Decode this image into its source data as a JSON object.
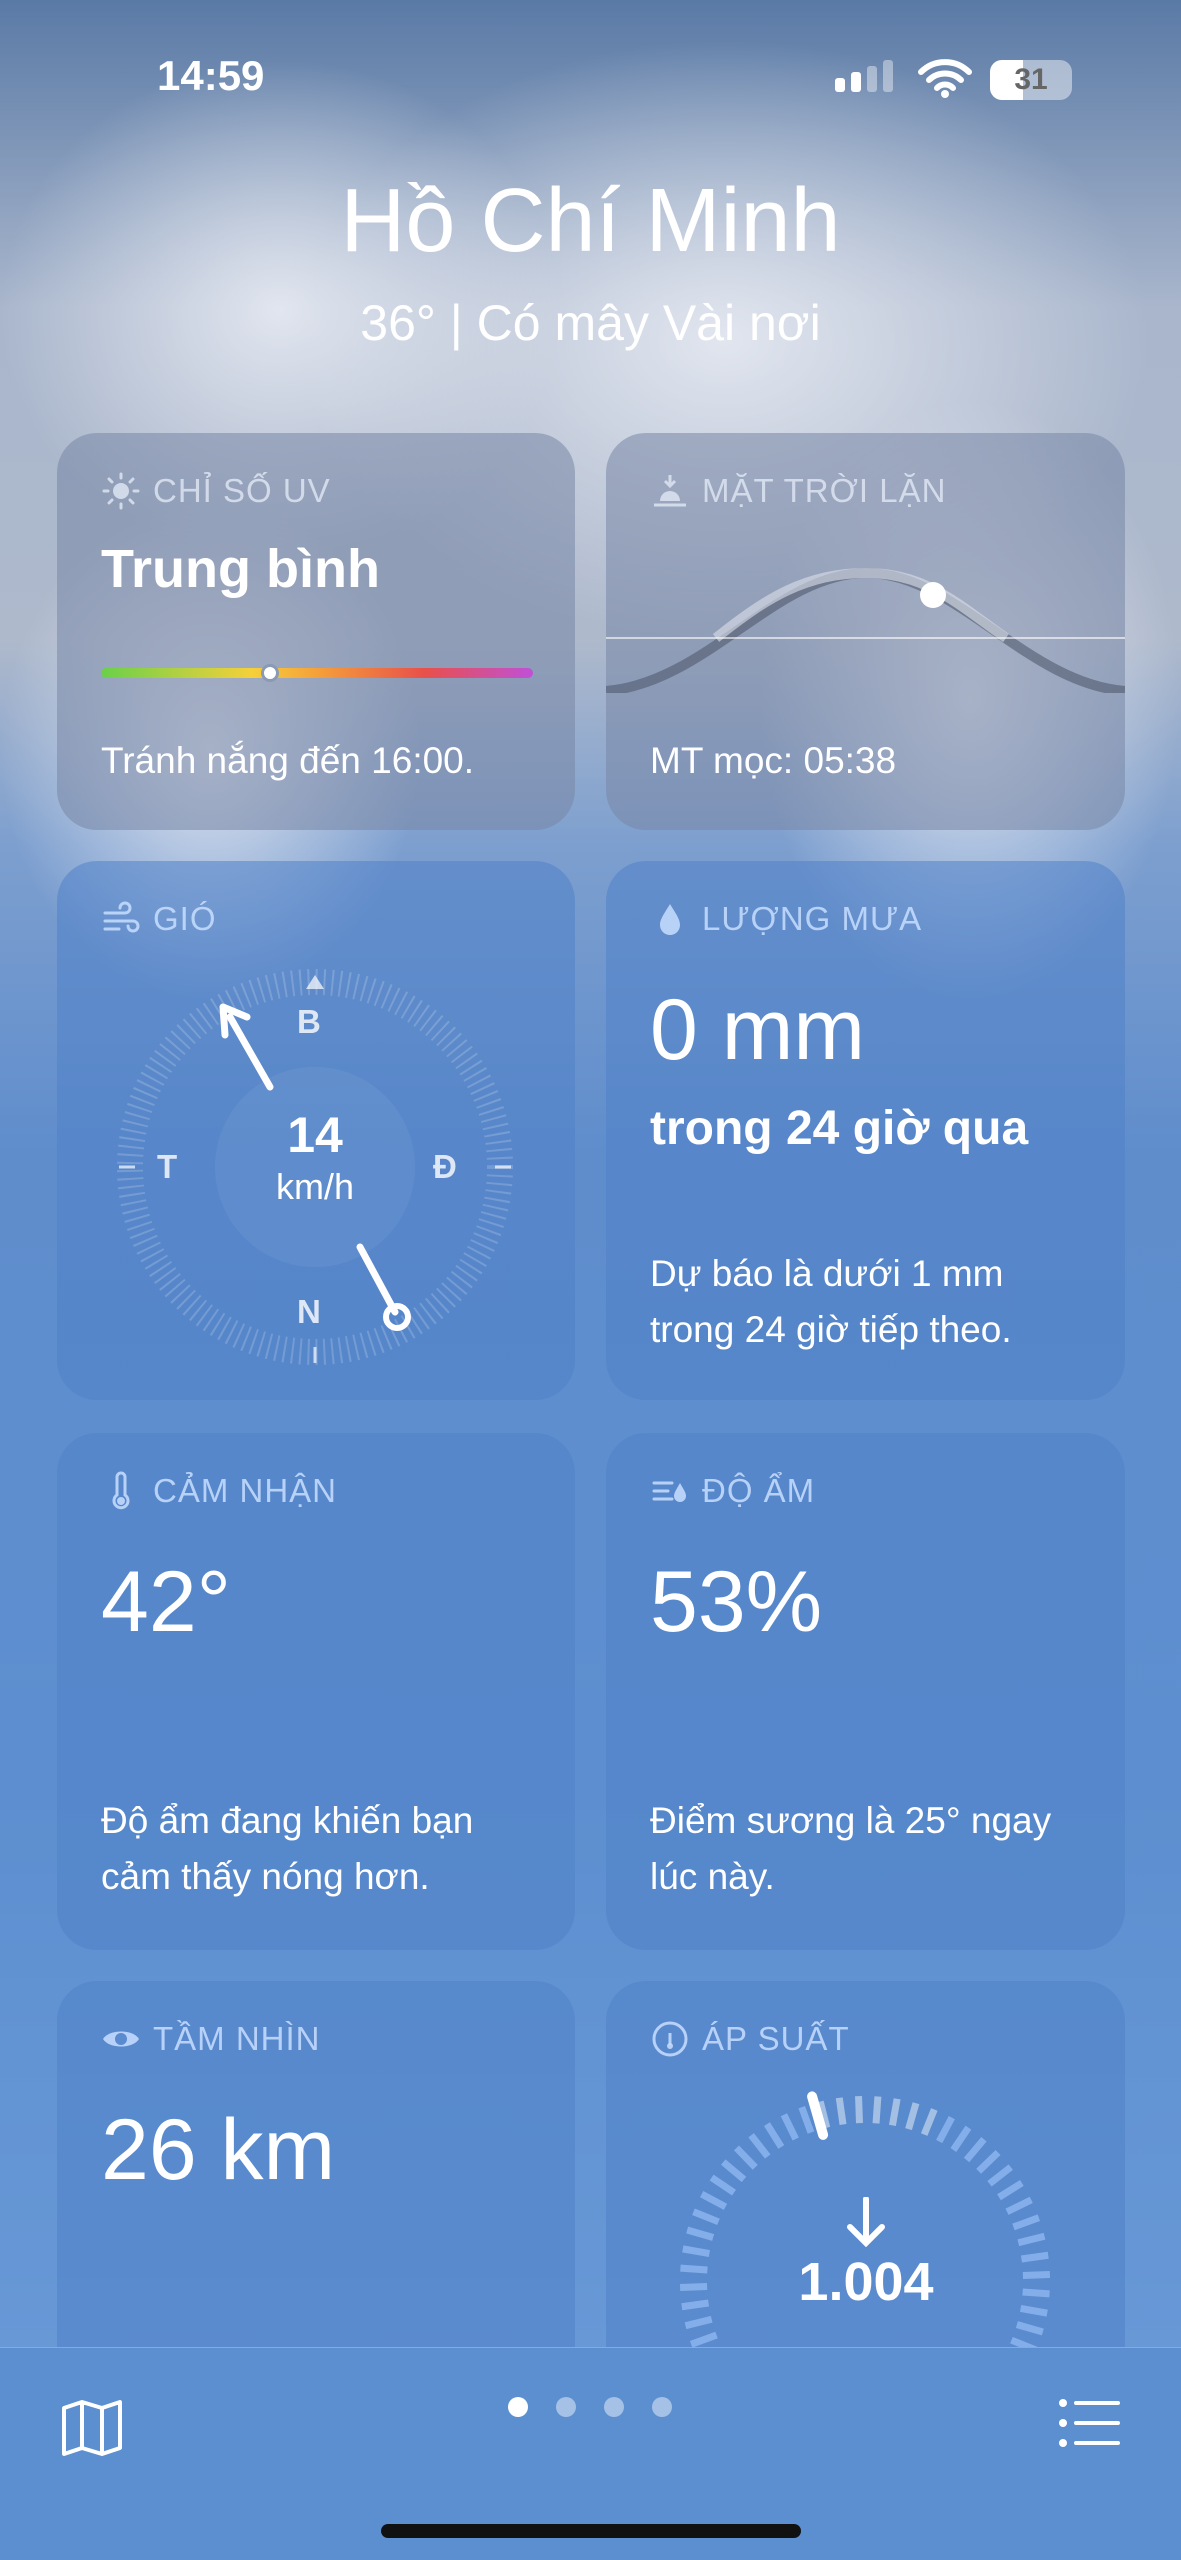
{
  "status_bar": {
    "time": "14:59",
    "battery": "31"
  },
  "header": {
    "city": "Hồ Chí Minh",
    "summary": "36°  |  Có mây Vài nơi"
  },
  "uv": {
    "label": "CHỈ SỐ UV",
    "level": "Trung bình",
    "desc": "Tránh nắng đến 16:00.",
    "icon": "sun-icon",
    "position": 0.37
  },
  "sunset": {
    "label": "MẶT TRỜI LẶN",
    "desc": "MT mọc: 05:38",
    "icon": "sunset-icon"
  },
  "wind": {
    "label": "GIÓ",
    "speed": "14",
    "unit": "km/h",
    "north": "B",
    "south": "N",
    "east": "Đ",
    "west": "T",
    "icon": "wind-icon",
    "direction_deg": 150
  },
  "rain": {
    "label": "LƯỢNG MƯA",
    "value": "0 mm",
    "period": "trong 24 giờ qua",
    "desc": "Dự báo là dưới 1 mm trong 24 giờ tiếp theo.",
    "icon": "raindrop-icon"
  },
  "feels": {
    "label": "CẢM NHẬN",
    "value": "42°",
    "desc": "Độ ẩm đang khiến bạn cảm thấy nóng hơn.",
    "icon": "thermometer-icon"
  },
  "humidity": {
    "label": "ĐỘ ẨM",
    "value": "53%",
    "desc": "Điểm sương là 25° ngay lúc này.",
    "icon": "humidity-icon"
  },
  "visibility": {
    "label": "TẦM NHÌN",
    "value": "26 km",
    "icon": "eye-icon"
  },
  "pressure": {
    "label": "ÁP SUẤT",
    "value": "1.004",
    "trend": "falling",
    "icon": "gauge-icon"
  },
  "tabbar": {
    "pages": 4,
    "active_page": 0
  }
}
